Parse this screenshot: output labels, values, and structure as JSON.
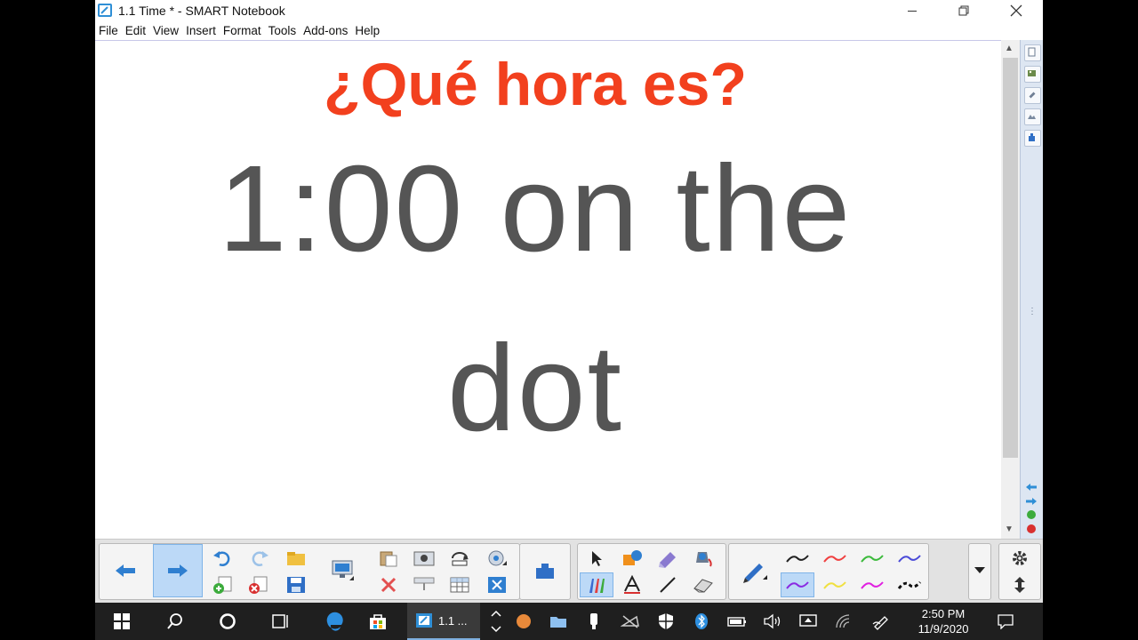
{
  "window": {
    "title": "1.1 Time * - SMART Notebook"
  },
  "menu": [
    "File",
    "Edit",
    "View",
    "Insert",
    "Format",
    "Tools",
    "Add-ons",
    "Help"
  ],
  "slide": {
    "heading": "¿Qué hora es?",
    "line1": "1:00 on the",
    "line2": "dot"
  },
  "colors": {
    "heading": "#f2401e",
    "body_text": "#555555",
    "accent_blue": "#2f8fd6"
  },
  "toolbar": {
    "icons": [
      "previous-page-icon",
      "next-page-icon",
      "undo-icon",
      "redo-icon",
      "open-file-icon",
      "add-page-icon",
      "delete-page-icon",
      "save-icon",
      "display-icon",
      "paste-icon",
      "delete-icon",
      "screen-capture-icon",
      "screen-shade-icon",
      "rotate-icon",
      "table-icon",
      "document-camera-icon",
      "fit-screen-icon",
      "addons-icon",
      "select-icon",
      "shapes-icon",
      "magic-pen-icon",
      "fill-icon",
      "pens-icon",
      "text-icon",
      "line-icon",
      "eraser-icon",
      "pen-icon",
      "settings-icon",
      "move-toolbar-icon"
    ],
    "pen_colors": [
      "#222222",
      "#f04040",
      "#3cba3c",
      "#4a4ad8",
      "#8a2be2",
      "#f0e040",
      "#e020e0",
      "#111111"
    ]
  },
  "taskbar": {
    "active_app_label": "1.1 ...",
    "time": "2:50 PM",
    "date": "11/9/2020"
  }
}
